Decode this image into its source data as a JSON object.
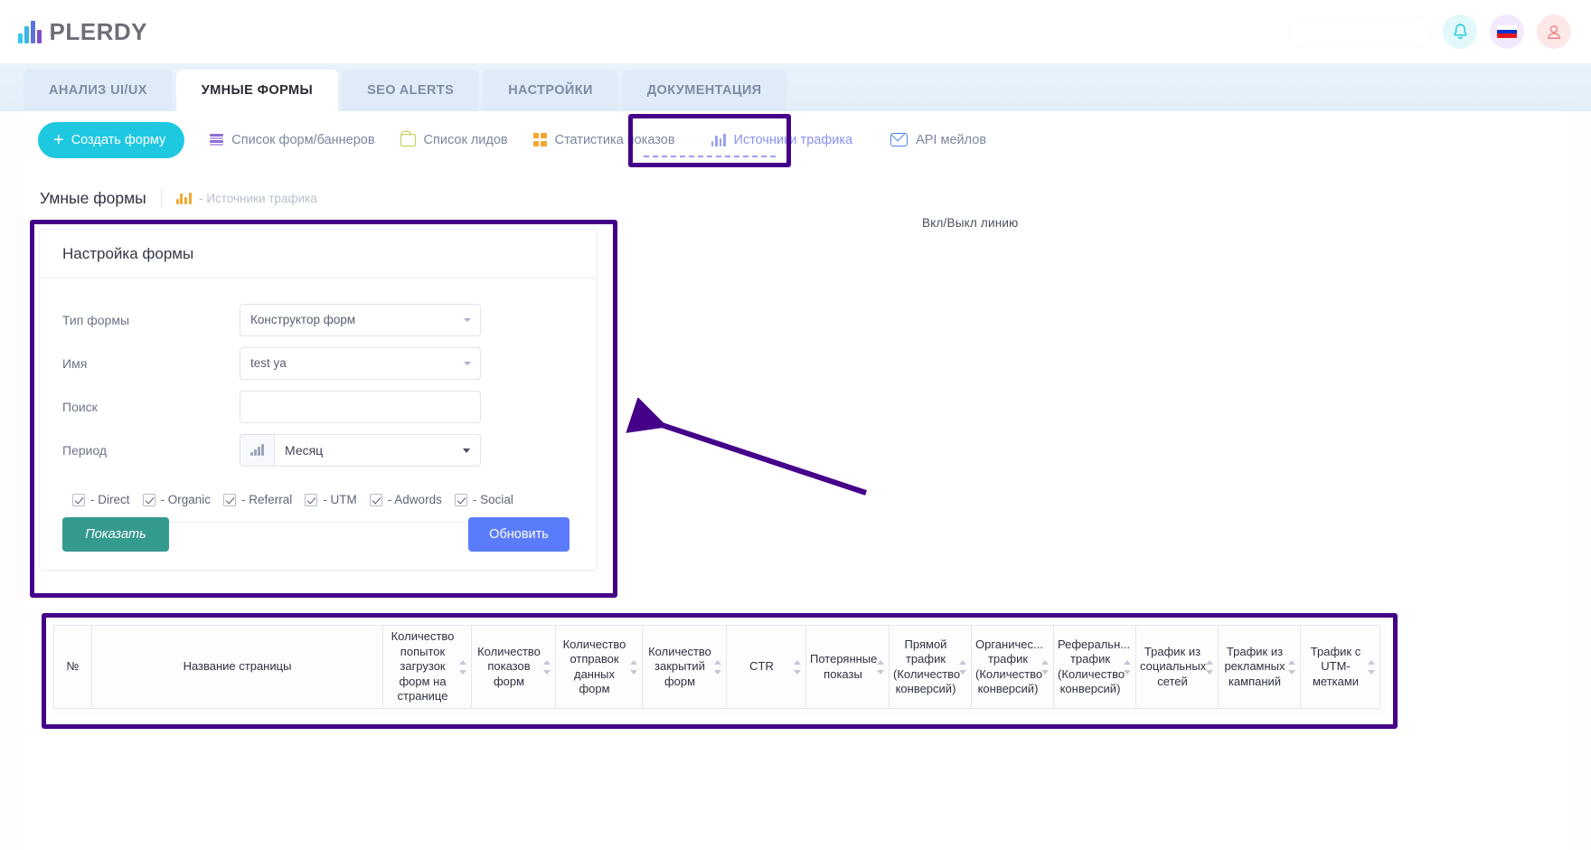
{
  "header": {
    "brand": "PLERDY",
    "search_placeholder": "",
    "bell_icon": "bell-icon",
    "flag_icon": "flag-ru-icon",
    "user_icon": "user-icon"
  },
  "tabs": [
    {
      "label": "АНАЛИЗ UI/UX",
      "active": false
    },
    {
      "label": "УМНЫЕ ФОРМЫ",
      "active": true
    },
    {
      "label": "SEO ALERTS",
      "active": false
    },
    {
      "label": "НАСТРОЙКИ",
      "active": false
    },
    {
      "label": "ДОКУМЕНТАЦИЯ",
      "active": false
    }
  ],
  "subnav": {
    "create_button": "Создать форму",
    "items": [
      {
        "label": "Список форм/баннеров",
        "icon": "list-icon"
      },
      {
        "label": "Список лидов",
        "icon": "folder-icon"
      },
      {
        "label": "Статистика показов",
        "icon": "grid-icon"
      },
      {
        "label": "Источники трафика",
        "icon": "bar-chart-icon"
      },
      {
        "label": "API мейлов",
        "icon": "mail-icon"
      }
    ]
  },
  "breadcrumb": {
    "title": "Умные формы",
    "sub": "- Источники трафика",
    "icon": "bar-chart-icon"
  },
  "panel": {
    "title": "Настройка формы",
    "fields": [
      {
        "label": "Тип формы",
        "value": "Конструктор форм",
        "kind": "select"
      },
      {
        "label": "Имя",
        "value": "test ya",
        "kind": "select"
      },
      {
        "label": "Поиск",
        "value": "",
        "kind": "input"
      },
      {
        "label": "Период",
        "value": "Месяц",
        "kind": "period"
      }
    ],
    "checkboxes": [
      {
        "label": "- Direct",
        "checked": true
      },
      {
        "label": "- Organic",
        "checked": true
      },
      {
        "label": "- Referral",
        "checked": true
      },
      {
        "label": "- UTM",
        "checked": true
      },
      {
        "label": "- Adwords",
        "checked": true
      },
      {
        "label": "- Social",
        "checked": true
      }
    ],
    "show_button": "Показать",
    "update_button": "Обновить"
  },
  "annotation": {
    "label": "Вкл/Выкл линию",
    "highlight_color": "#440089"
  },
  "table": {
    "columns": [
      {
        "label": "№",
        "sortable": false
      },
      {
        "label": "Название страницы",
        "sortable": false
      },
      {
        "label": "Количество попыток загрузок форм на странице",
        "sortable": true
      },
      {
        "label": "Количество показов форм",
        "sortable": true
      },
      {
        "label": "Количество отправок данных форм",
        "sortable": true
      },
      {
        "label": "Количество закрытий форм",
        "sortable": true
      },
      {
        "label": "CTR",
        "sortable": true
      },
      {
        "label": "Потерянные показы",
        "sortable": true
      },
      {
        "label": "Прямой трафик (Количество конверсий)",
        "sortable": true
      },
      {
        "label": "Органичес... трафик (Количество конверсий)",
        "sortable": true
      },
      {
        "label": "Реферальн... трафик (Количество конверсий)",
        "sortable": true
      },
      {
        "label": "Трафик из социальных сетей",
        "sortable": true
      },
      {
        "label": "Трафик из рекламных кампаний",
        "sortable": true
      },
      {
        "label": "Трафик с UTM-метками",
        "sortable": true
      }
    ],
    "rows": []
  }
}
